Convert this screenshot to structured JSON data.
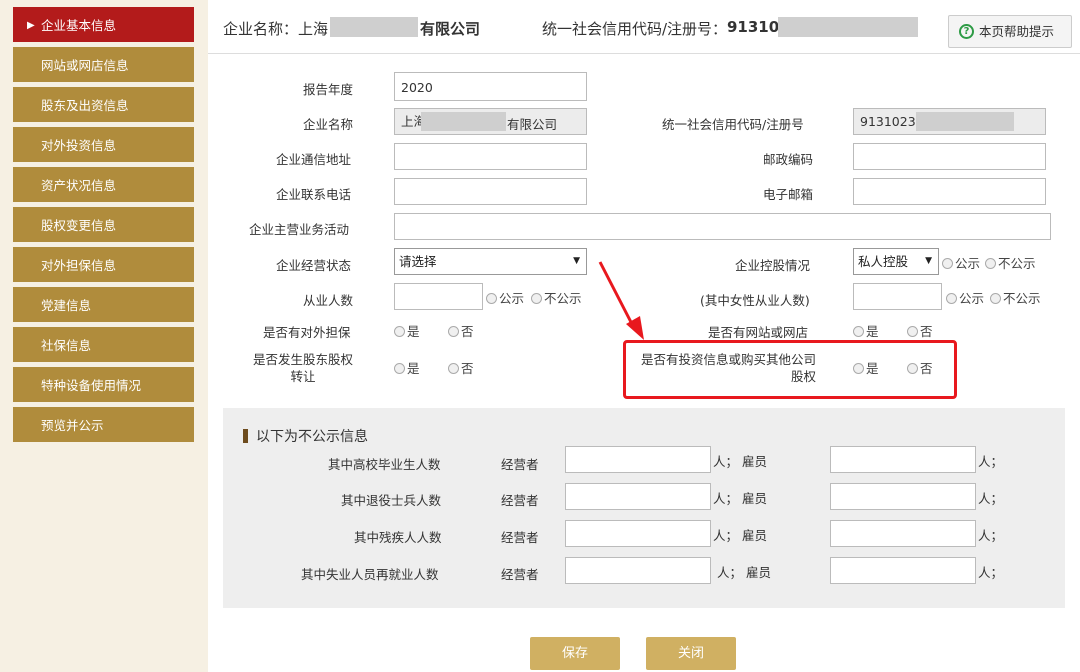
{
  "sidebar": {
    "items": [
      {
        "label": "企业基本信息",
        "active": true
      },
      {
        "label": "网站或网店信息"
      },
      {
        "label": "股东及出资信息"
      },
      {
        "label": "对外投资信息"
      },
      {
        "label": "资产状况信息"
      },
      {
        "label": "股权变更信息"
      },
      {
        "label": "对外担保信息"
      },
      {
        "label": "党建信息"
      },
      {
        "label": "社保信息"
      },
      {
        "label": "特种设备使用情况"
      },
      {
        "label": "预览并公示"
      }
    ]
  },
  "header": {
    "company_label": "企业名称：上海",
    "company_suffix": "有限公司",
    "credit_label": "统一社会信用代码/注册号：",
    "credit_prefix": "91310",
    "help_label": "本页帮助提示"
  },
  "form": {
    "report_year_label": "报告年度",
    "report_year_value": "2020",
    "company_name_label": "企业名称",
    "company_name_prefix": "上海",
    "company_name_suffix": "有限公司",
    "credit_code_label": "统一社会信用代码/注册号",
    "credit_code_value": "91310230",
    "address_label": "企业通信地址",
    "postcode_label": "邮政编码",
    "phone_label": "企业联系电话",
    "email_label": "电子邮箱",
    "business_label": "企业主营业务活动",
    "status_label": "企业经营状态",
    "status_value": "请选择",
    "holding_label": "企业控股情况",
    "holding_value": "私人控股",
    "public_label": "公示",
    "nonpublic_label": "不公示",
    "employees_label": "从业人数",
    "female_label": "(其中女性从业人数)",
    "guarantee_label": "是否有对外担保",
    "website_label": "是否有网站或网店",
    "transfer_label_1": "是否发生股东股权",
    "transfer_label_2": "转让",
    "invest_label_1": "是否有投资信息或购买其他公司",
    "invest_label_2": "股权",
    "yes_label": "是",
    "no_label": "否"
  },
  "nonpublic": {
    "title": "以下为不公示信息",
    "rows": [
      {
        "label": "其中高校毕业生人数"
      },
      {
        "label": "其中退役士兵人数"
      },
      {
        "label": "其中残疾人人数"
      },
      {
        "label": "其中失业人员再就业人数"
      }
    ],
    "operator_label": "经营者",
    "unit_employee_label": "人； 雇员",
    "unit_label": "人；"
  },
  "buttons": {
    "save": "保存",
    "close": "关闭"
  },
  "colors": {
    "sidebar_item": "#b08c3c",
    "sidebar_active": "#b31b1b",
    "highlight": "#e8181e",
    "button": "#d0b062"
  }
}
